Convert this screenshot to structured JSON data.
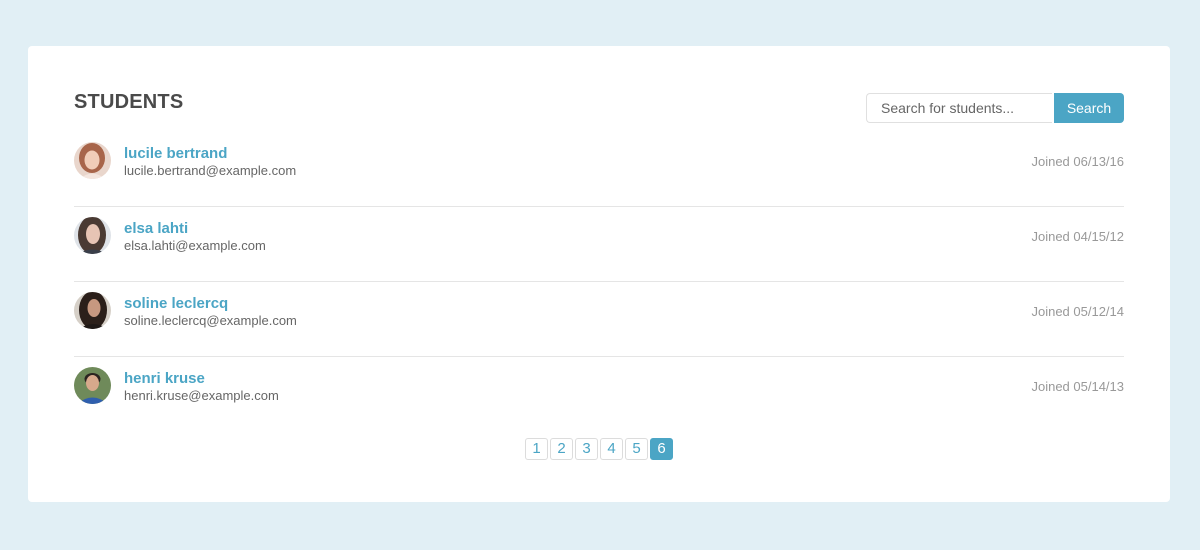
{
  "header": {
    "title": "STUDENTS",
    "search_placeholder": "Search for students...",
    "search_value": "",
    "search_button": "Search"
  },
  "students": [
    {
      "name": "lucile bertrand",
      "email": "lucile.bertrand@example.com",
      "joined": "Joined 06/13/16"
    },
    {
      "name": "elsa lahti",
      "email": "elsa.lahti@example.com",
      "joined": "Joined 04/15/12"
    },
    {
      "name": "soline leclercq",
      "email": "soline.leclercq@example.com",
      "joined": "Joined 05/12/14"
    },
    {
      "name": "henri kruse",
      "email": "henri.kruse@example.com",
      "joined": "Joined 05/14/13"
    }
  ],
  "pagination": {
    "pages": [
      "1",
      "2",
      "3",
      "4",
      "5",
      "6"
    ],
    "active": "6"
  },
  "colors": {
    "accent": "#4ba5c5",
    "background": "#e1eff5"
  }
}
